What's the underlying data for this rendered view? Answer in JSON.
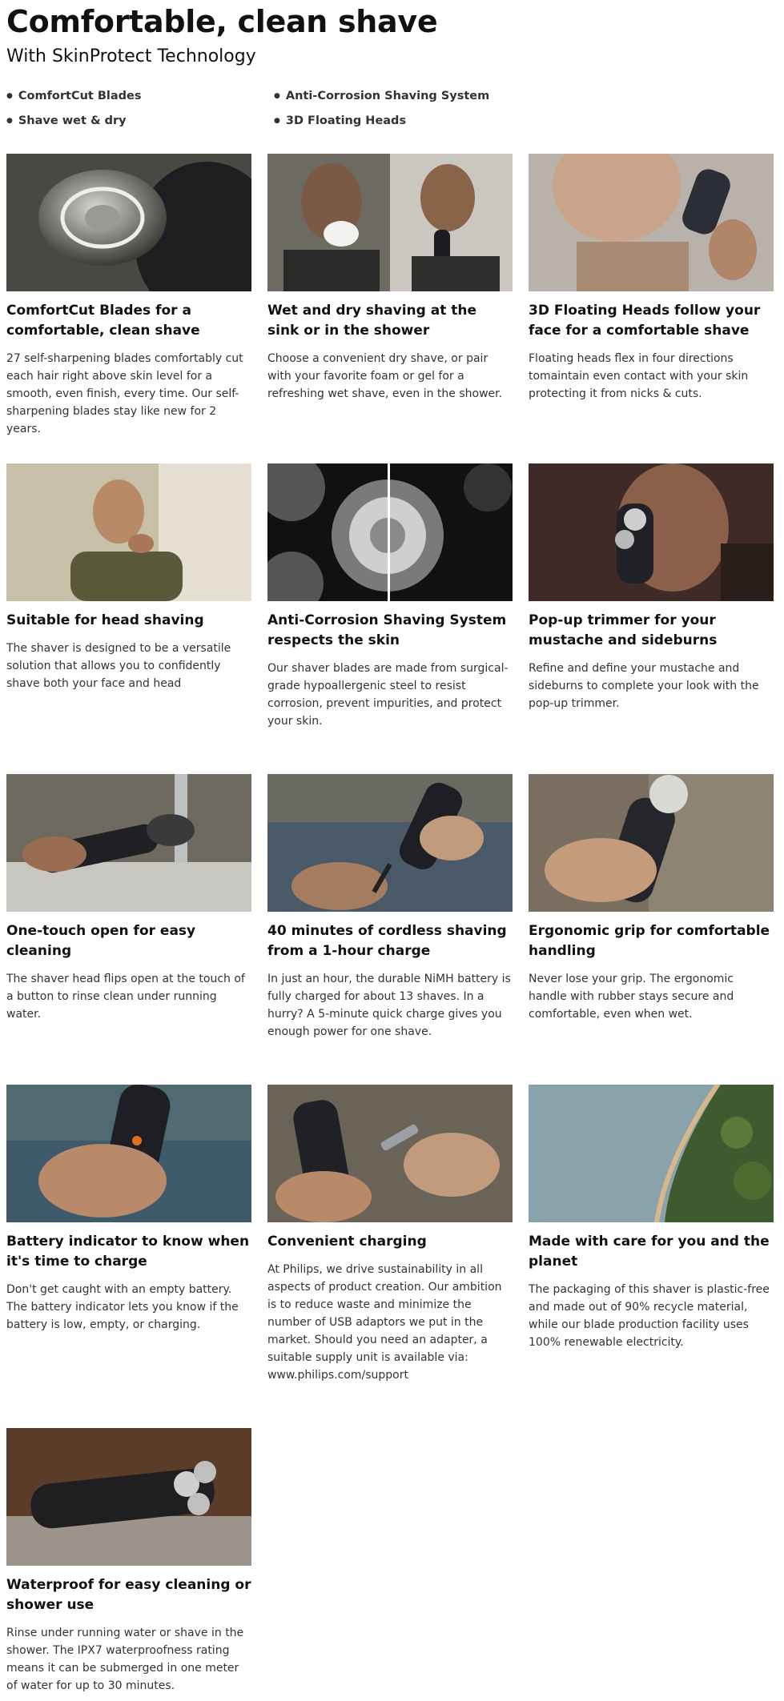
{
  "title": "Comfortable, clean shave",
  "subtitle": "With SkinProtect Technology",
  "highlights": [
    "ComfortCut Blades",
    "Anti-Corrosion Shaving System",
    "Shave wet & dry",
    "3D Floating Heads"
  ],
  "features": [
    {
      "title": "ComfortCut Blades for a comfortable, clean shave",
      "text": "27 self-sharpening blades comfortably cut each hair right above skin level for a smooth, even finish, every time. Our self-sharpening blades stay like new for 2 years."
    },
    {
      "title": "Wet and dry shaving at the sink or in the shower",
      "text": "Choose a convenient dry shave, or pair with your favorite foam or gel for a refreshing wet shave, even in the shower."
    },
    {
      "title": "3D Floating Heads follow your face for a comfortable shave",
      "text": "Floating heads flex in four directions tomaintain even contact with your skin protecting it from nicks & cuts."
    },
    {
      "title": "Suitable for head shaving",
      "text": "The shaver is designed to be a versatile solution that allows you to confidently shave both your face and head"
    },
    {
      "title": "Anti-Corrosion Shaving System respects the skin",
      "text": "Our shaver blades are made from surgical-grade hypoallergenic steel to resist corrosion, prevent impurities, and protect your skin."
    },
    {
      "title": "Pop-up trimmer for your mustache and sideburns",
      "text": "Refine and define your mustache and sideburns to complete your look with the pop-up trimmer."
    },
    {
      "title": "One-touch open for easy cleaning",
      "text": "The shaver head flips open at the touch of a button to rinse clean under running water."
    },
    {
      "title": "40 minutes of cordless shaving from a 1-hour charge",
      "text": "In just an hour, the durable NiMH battery is fully charged for about 13 shaves. In a hurry? A 5-minute quick charge gives you enough power for one shave."
    },
    {
      "title": "Ergonomic grip for comfortable handling",
      "text": "Never lose your grip. The ergonomic handle with rubber stays secure and comfortable, even when wet."
    },
    {
      "title": "Battery indicator to know when it's time to charge",
      "text": "Don't get caught with an empty battery. The battery indicator lets you know if the battery is low, empty, or charging."
    },
    {
      "title": "Convenient charging",
      "text": "At Philips, we drive sustainability in all aspects of product creation. Our ambition is to reduce waste and minimize the number of USB adaptors we put in the market. Should you need an adapter, a suitable supply unit is available via: www.philips.com/support"
    },
    {
      "title": "Made with care for you and the planet",
      "text": "The packaging of this shaver is plastic-free and made out of 90% recycle material, while our blade production facility uses 100% renewable electricity."
    },
    {
      "title": "Waterproof for easy cleaning or shower use",
      "text": "Rinse under running water or shave in the shower. The IPX7 waterproofness rating means it can be submerged in one meter of water for up to 30 minutes."
    }
  ]
}
